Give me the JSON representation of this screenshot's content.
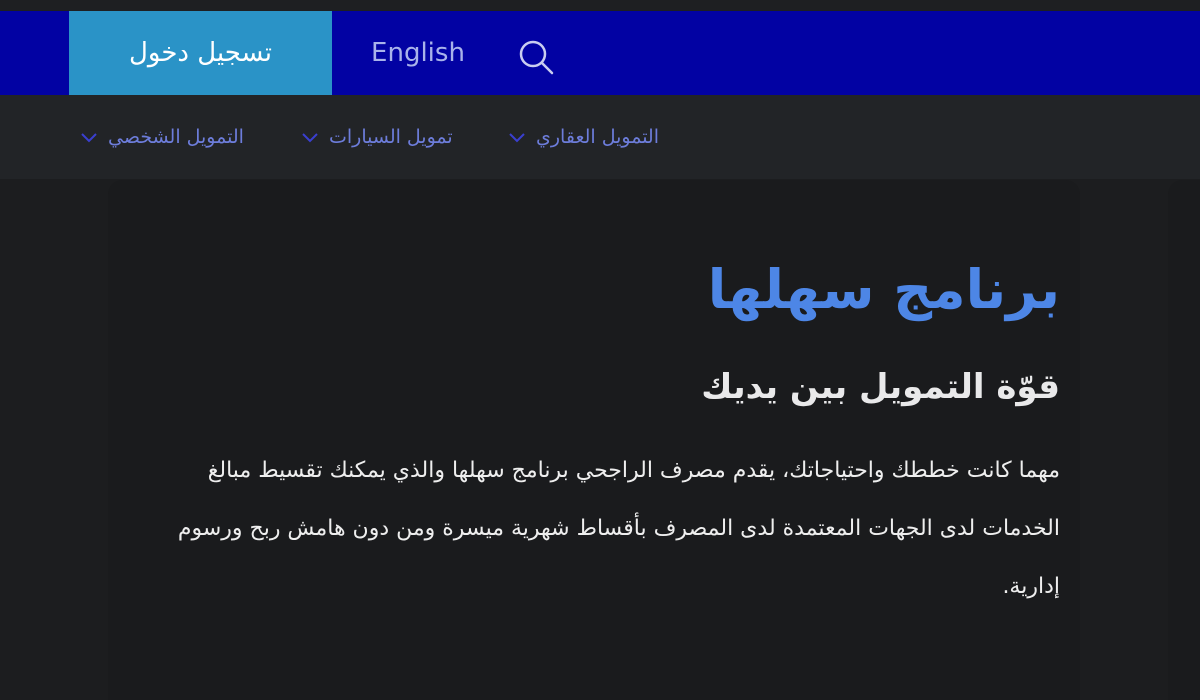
{
  "header": {
    "login_label": "تسجيل دخول",
    "language_label": "English",
    "search_icon": "search-icon"
  },
  "nav": {
    "items": [
      {
        "label": "التمويل العقاري"
      },
      {
        "label": "تمويل السيارات"
      },
      {
        "label": "التمويل الشخصي"
      }
    ]
  },
  "main": {
    "title": "برنامج سهلها",
    "subtitle": "قوّة التمويل بين يديك",
    "body": "مهما كانت خططك واحتياجاتك، يقدم مصرف الراجحي برنامج سهلها والذي يمكنك تقسيط مبالغ الخدمات لدى الجهات المعتمدة لدى المصرف بأقساط شهرية ميسرة ومن دون هامش ربح ورسوم إدارية."
  },
  "colors": {
    "header_bg": "#0202a3",
    "login_bg": "#2a93c7",
    "title": "#4d86e6",
    "nav_text": "#6d7ddb"
  }
}
